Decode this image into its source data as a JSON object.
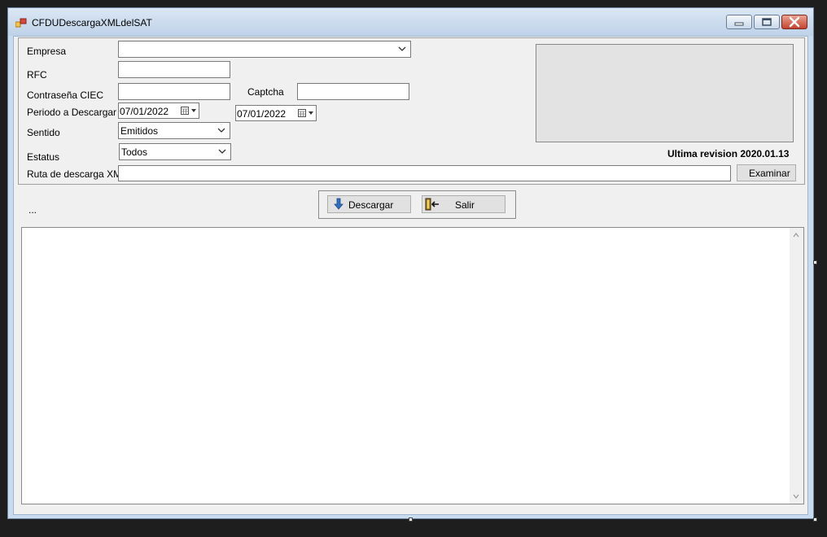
{
  "window": {
    "title": "CFDUDescargaXMLdelSAT",
    "app_icon": "form-designer-icon"
  },
  "form": {
    "empresa": {
      "label": "Empresa",
      "value": ""
    },
    "rfc": {
      "label": "RFC",
      "value": ""
    },
    "ciec": {
      "label": "Contraseña CIEC",
      "value": ""
    },
    "captcha": {
      "label": "Captcha",
      "value": ""
    },
    "periodo": {
      "label": "Periodo a Descargar",
      "from": "07/01/2022",
      "to": "07/01/2022"
    },
    "sentido": {
      "label": "Sentido",
      "value": "Emitidos"
    },
    "estatus": {
      "label": "Estatus",
      "value": "Todos"
    },
    "ruta": {
      "label": "Ruta de descarga XML",
      "value": "",
      "browse_label": "Examinar"
    },
    "revision": "Ultima revision 2020.01.13"
  },
  "actions": {
    "descargar_label": "Descargar",
    "descargar_icon": "down-arrow-icon",
    "salir_label": "Salir",
    "salir_icon": "exit-door-icon"
  },
  "status_text": "...",
  "log": {
    "value": ""
  },
  "colors": {
    "title_bar": "#c9dbee",
    "close_button": "#c7432e",
    "client_background": "#f0f0f0"
  }
}
